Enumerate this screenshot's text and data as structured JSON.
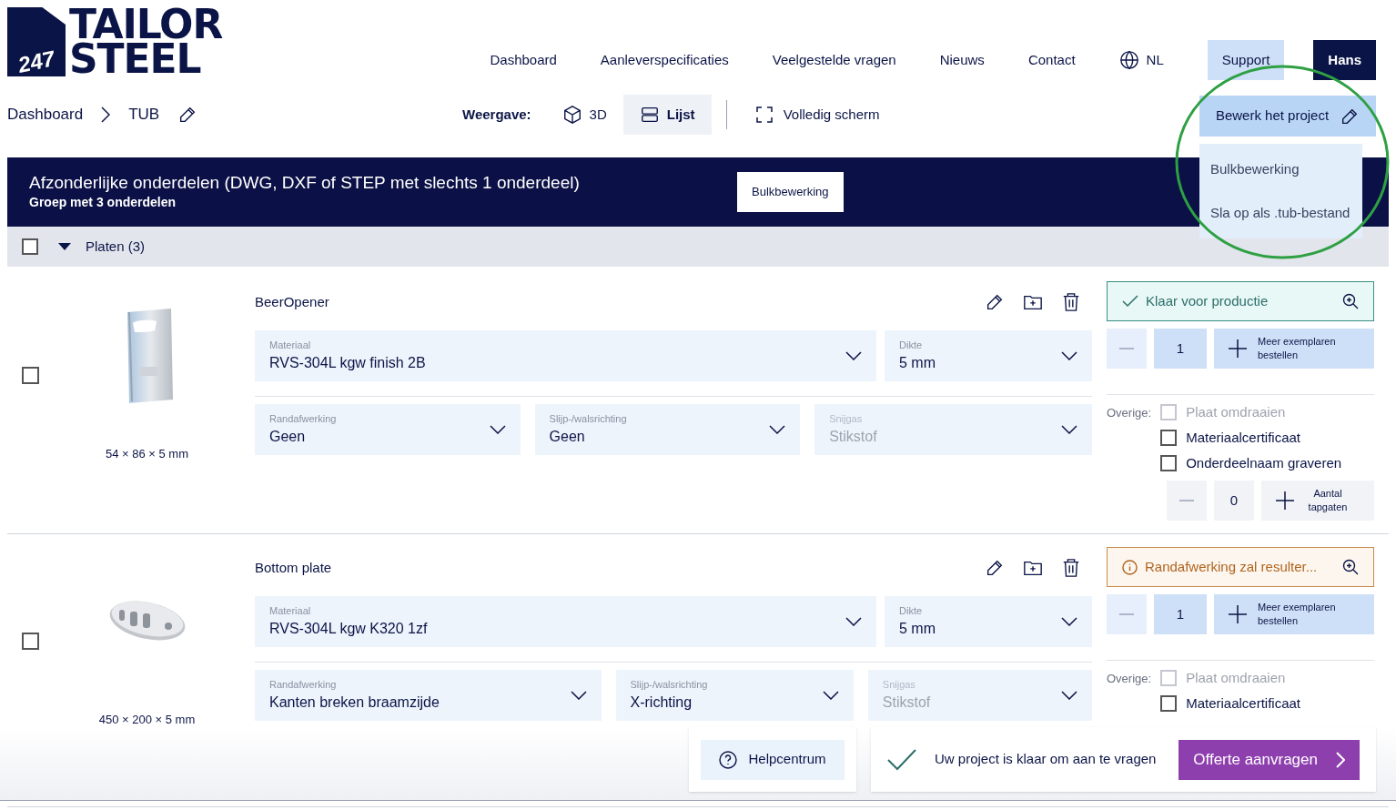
{
  "logo": {
    "badge": "247",
    "line1": "TAILOR",
    "line2": "STEEL"
  },
  "nav": [
    {
      "label": "Dashboard",
      "kind": "link"
    },
    {
      "label": "Aanleverspecificaties",
      "kind": "link"
    },
    {
      "label": "Veelgestelde vragen",
      "kind": "link"
    },
    {
      "label": "Nieuws",
      "kind": "link"
    },
    {
      "label": "Contact",
      "kind": "link"
    },
    {
      "label": "NL",
      "kind": "language"
    },
    {
      "label": "Support",
      "kind": "support"
    },
    {
      "label": "Hans",
      "kind": "user"
    }
  ],
  "breadcrumb": [
    "Dashboard",
    "TUB"
  ],
  "view": {
    "label": "Weergave:",
    "options": [
      {
        "label": "3D",
        "kind": "cube",
        "selected": false
      },
      {
        "label": "Lijst",
        "kind": "list",
        "selected": true
      }
    ],
    "fullscreen": "Volledig scherm"
  },
  "project_menu": {
    "button": "Bewerk het project",
    "expanded": true,
    "items": [
      "Bulkbewerking",
      "Sla op als .tub-bestand"
    ]
  },
  "group": {
    "title": "Afzonderlijke onderdelen (DWG, DXF of STEP met slechts 1 onderdeel)",
    "subtitle": "Groep met 3 onderdelen",
    "bulk_button": "Bulkbewerking"
  },
  "category": {
    "label": "Platen (3)",
    "checked": false,
    "expanded": true
  },
  "parts": [
    {
      "name": "BeerOpener",
      "checked": false,
      "dimensions": "54 × 86 × 5 mm",
      "status": {
        "kind": "ok",
        "text": "Klaar voor productie"
      },
      "fields_top": [
        {
          "label": "Materiaal",
          "value": "RVS-304L kgw finish 2B",
          "disabled": false
        },
        {
          "label": "Dikte",
          "value": "5 mm",
          "disabled": false
        }
      ],
      "fields_bottom": [
        {
          "label": "Randafwerking",
          "value": "Geen",
          "disabled": false
        },
        {
          "label": "Slijp-/walsrichting",
          "value": "Geen",
          "disabled": false
        },
        {
          "label": "Snijgas",
          "value": "Stikstof",
          "disabled": true
        }
      ],
      "quantity": "1",
      "order_more": "Meer exemplaren bestellen",
      "other_label": "Overige:",
      "options": [
        {
          "label": "Plaat omdraaien",
          "checked": false,
          "disabled": true
        },
        {
          "label": "Materiaalcertificaat",
          "checked": false,
          "disabled": false
        },
        {
          "label": "Onderdeelnaam graveren",
          "checked": false,
          "disabled": false
        }
      ],
      "taps": {
        "count": "0",
        "label": "Aantal tapgaten"
      }
    },
    {
      "name": "Bottom plate",
      "checked": false,
      "dimensions": "450 × 200 × 5 mm",
      "status": {
        "kind": "warning",
        "text": "Randafwerking zal resulter..."
      },
      "fields_top": [
        {
          "label": "Materiaal",
          "value": "RVS-304L kgw K320 1zf",
          "disabled": false
        },
        {
          "label": "Dikte",
          "value": "5 mm",
          "disabled": false
        }
      ],
      "fields_bottom": [
        {
          "label": "Randafwerking",
          "value": "Kanten breken braamzijde",
          "disabled": false
        },
        {
          "label": "Slijp-/walsrichting",
          "value": "X-richting",
          "disabled": false
        },
        {
          "label": "Snijgas",
          "value": "Stikstof",
          "disabled": true
        }
      ],
      "quantity": "1",
      "order_more": "Meer exemplaren bestellen",
      "other_label": "Overige:",
      "options": [
        {
          "label": "Plaat omdraaien",
          "checked": false,
          "disabled": true
        },
        {
          "label": "Materiaalcertificaat",
          "checked": false,
          "disabled": false
        }
      ]
    }
  ],
  "footer": {
    "help": "Helpcentrum",
    "ready": "Uw project is klaar om aan te vragen",
    "submit": "Offerte aanvragen"
  }
}
